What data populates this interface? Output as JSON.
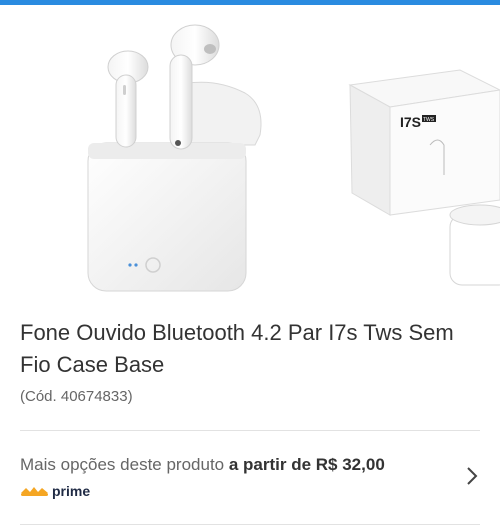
{
  "header": {
    "accent_color": "#2a8be0"
  },
  "gallery": {
    "images": [
      {
        "icon": "earbuds-case-photo"
      },
      {
        "icon": "product-box-photo",
        "box_label": "I7S",
        "box_badge": "TWS"
      }
    ]
  },
  "product": {
    "title": "Fone Ouvido Bluetooth 4.2 Par I7s Tws Sem Fio Case Base",
    "code": "(Cód. 40674833)"
  },
  "offer": {
    "text_prefix": "Mais opções deste produto ",
    "text_bold": "a partir de R$ 32,00",
    "prime_label": "prime",
    "prime_color": "#f5a623"
  }
}
